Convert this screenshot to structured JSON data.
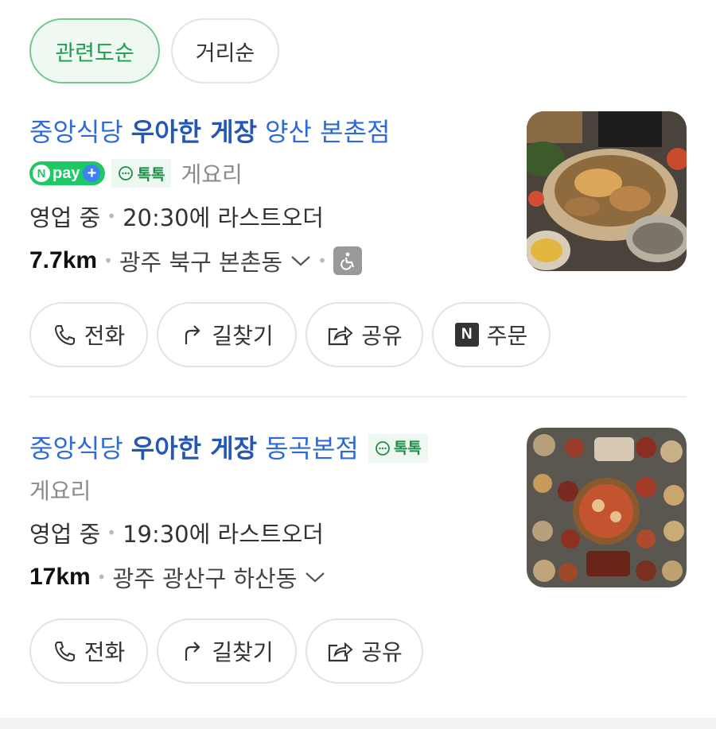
{
  "sort": {
    "related": "관련도순",
    "distance": "거리순"
  },
  "results": [
    {
      "brand": "중앙식당",
      "highlight": "우아한 게장",
      "branch": "양산 본촌점",
      "npay": {
        "n": "N",
        "text": "pay",
        "plus": "+"
      },
      "talk": "톡톡",
      "category": "게요리",
      "status": "영업 중",
      "last_order": "20:30에 라스트오더",
      "distance": "7.7km",
      "address": "광주 북구 본촌동",
      "buttons": {
        "call": "전화",
        "route": "길찾기",
        "share": "공유",
        "order": "주문",
        "order_badge": "N"
      }
    },
    {
      "brand": "중앙식당",
      "highlight": "우아한 게장",
      "branch": "동곡본점",
      "talk": "톡톡",
      "category": "게요리",
      "status": "영업 중",
      "last_order": "19:30에 라스트오더",
      "distance": "17km",
      "address": "광주 광산구 하산동",
      "buttons": {
        "call": "전화",
        "route": "길찾기",
        "share": "공유"
      }
    }
  ],
  "icons": [
    "phone-icon",
    "route-arrow-icon",
    "share-icon",
    "naver-order-icon",
    "chat-bubble-icon",
    "wheelchair-icon",
    "chevron-down-icon"
  ],
  "colors": {
    "accent_green": "#1f9e4e",
    "title_blue": "#2d6bd8",
    "npay_green": "#1ec864"
  }
}
